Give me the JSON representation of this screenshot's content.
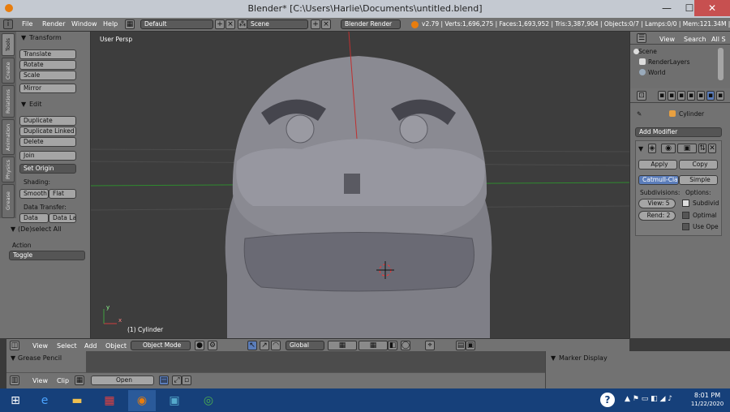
{
  "window": {
    "title": "Blender* [C:\\Users\\Harlie\\Documents\\untitled.blend]",
    "min": "—",
    "max": "☐",
    "close": "✕"
  },
  "info": {
    "menus": [
      "File",
      "Render",
      "Window",
      "Help"
    ],
    "layout": "Default",
    "scene": "Scene",
    "engine": "Blender Render",
    "stats": "v2.79 | Verts:1,696,275 | Faces:1,693,952 | Tris:3,387,904 | Objects:0/7 | Lamps:0/0 | Mem:121.34M | Cylinde"
  },
  "toolshelf": {
    "tabs": [
      "Tools",
      "Create",
      "Relations",
      "Animation",
      "Physics",
      "Grease Pencil"
    ],
    "transform": {
      "header": "Transform",
      "buttons": [
        "Translate",
        "Rotate",
        "Scale"
      ],
      "mirror": "Mirror"
    },
    "edit": {
      "header": "Edit",
      "buttons": [
        "Duplicate",
        "Duplicate Linked",
        "Delete"
      ],
      "join": "Join",
      "set_origin": "Set Origin",
      "shading_label": "Shading:",
      "smooth": "Smooth",
      "flat": "Flat",
      "data_transfer_label": "Data Transfer:",
      "data": "Data",
      "data_la": "Data La"
    },
    "operator": {
      "header": "(De)select All",
      "action_label": "Action",
      "action_value": "Toggle"
    }
  },
  "viewport": {
    "view_label": "User Persp",
    "object_label": "(1) Cylinder",
    "axis_x": "x",
    "axis_y": "y"
  },
  "viewport_header": {
    "menus": [
      "View",
      "Select",
      "Add",
      "Object"
    ],
    "mode": "Object Mode",
    "orientation": "Global"
  },
  "grease_pencil": {
    "header": "Grease Pencil"
  },
  "timeline": {
    "menus": [
      "View",
      "Clip"
    ],
    "open": "Open"
  },
  "outliner": {
    "tabs": [
      "View",
      "Search",
      "All S"
    ],
    "items": [
      "Scene",
      "RenderLayers",
      "World"
    ]
  },
  "properties": {
    "object": "Cylinder",
    "add_modifier": "Add Modifier",
    "apply": "Apply",
    "copy": "Copy",
    "catmull": "Catmull-Clark",
    "simple": "Simple",
    "subdivisions": "Subdivisions:",
    "options": "Options:",
    "view_level": "View: 5",
    "render_level": "Rend: 2",
    "opt1": "Subdivid",
    "opt2": "Optimal",
    "opt3": "Use Ope"
  },
  "marker": {
    "header": "Marker Display"
  },
  "taskbar": {
    "time": "8:01 PM",
    "date": "11/22/2020",
    "help": "?"
  }
}
